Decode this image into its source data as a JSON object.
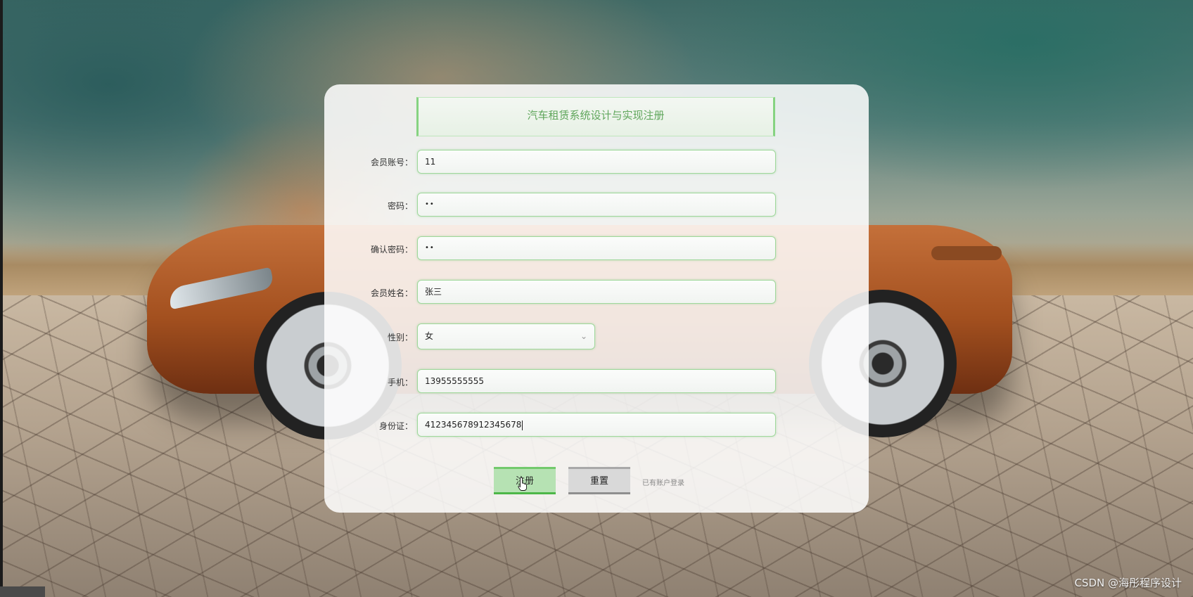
{
  "form": {
    "title": "汽车租赁系统设计与实现注册",
    "fields": [
      {
        "label": "会员账号：",
        "value": "11"
      },
      {
        "label": "密码：",
        "value": "••"
      },
      {
        "label": "确认密码：",
        "value": "••"
      },
      {
        "label": "会员姓名：",
        "value": "张三"
      },
      {
        "label": "性别：",
        "value": "女"
      },
      {
        "label": "手机：",
        "value": "13955555555"
      },
      {
        "label": "身份证：",
        "value": "412345678912345678"
      }
    ]
  },
  "buttons": {
    "submit_label": "注册",
    "reset_label": "重置",
    "login_link": "已有账户登录"
  },
  "watermark": "CSDN @海彤程序设计",
  "colors": {
    "accent_green": "#86d381",
    "title_green": "#5fa65b",
    "submit_bg": "#b6e2b3",
    "reset_bg": "#d9d9d9"
  },
  "icons": {
    "select_chevron": "chevron-down-icon",
    "mouse_cursor": "hand-cursor-icon"
  }
}
